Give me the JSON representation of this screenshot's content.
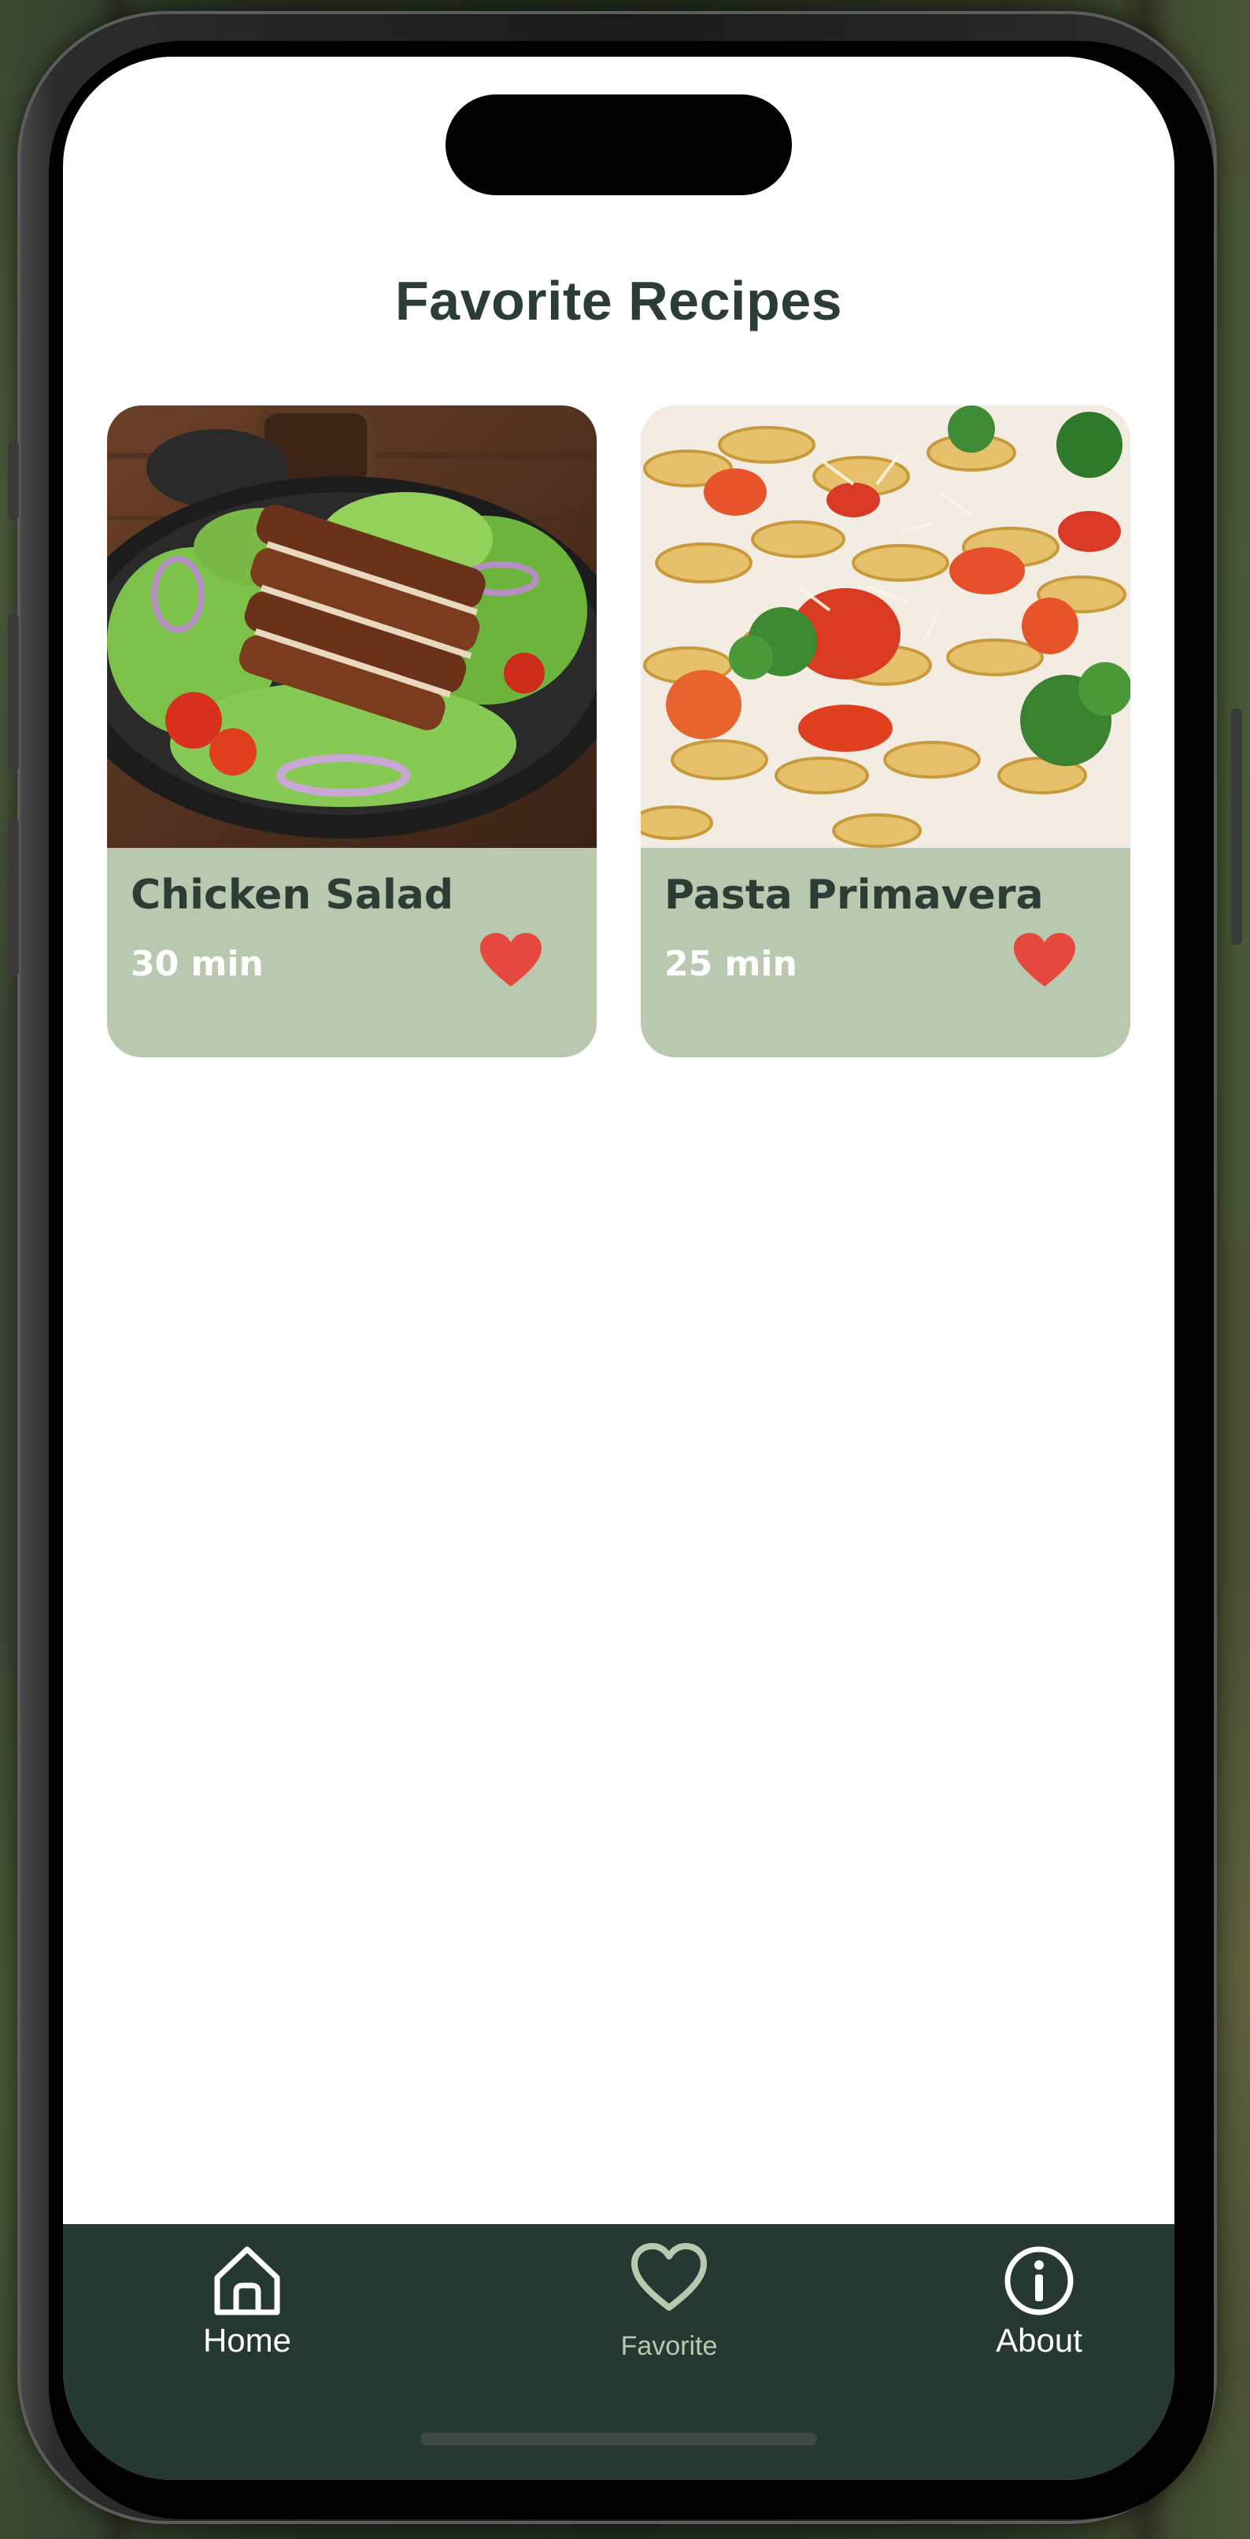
{
  "page": {
    "title": "Favorite Recipes"
  },
  "recipes": [
    {
      "name": "Chicken Salad",
      "time": "30 min",
      "favorite": true,
      "image": "chicken-salad-photo"
    },
    {
      "name": "Pasta Primavera",
      "time": "25 min",
      "favorite": true,
      "image": "pasta-primavera-photo"
    }
  ],
  "tabbar": {
    "items": [
      {
        "label": "Home",
        "icon": "home-icon",
        "active": false
      },
      {
        "label": "Favorite",
        "icon": "heart-outline-icon",
        "active": true
      },
      {
        "label": "About",
        "icon": "info-icon",
        "active": false
      }
    ]
  },
  "colors": {
    "accent_dark": "#263832",
    "card_bg": "#b9c9b0",
    "title_text": "#2b3d34",
    "heart": "#e5483e",
    "screen_bg": "#ffffff"
  }
}
